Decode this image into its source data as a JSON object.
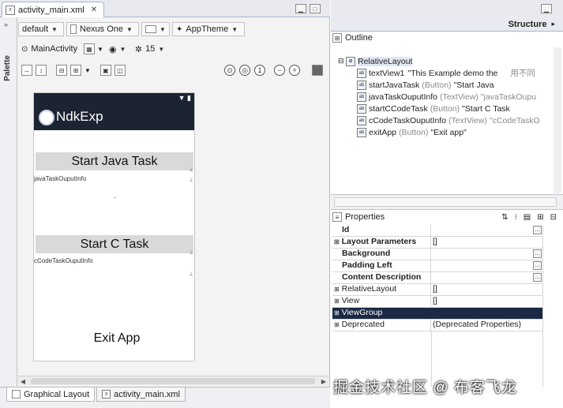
{
  "editor_tab": {
    "title": "activity_main.xml"
  },
  "palette": {
    "label": "Palette"
  },
  "toolbar1": {
    "config": "default",
    "device": "Nexus One",
    "theme": "AppTheme"
  },
  "toolbar2": {
    "activity": "MainActivity",
    "api": "15"
  },
  "device_preview": {
    "app_title": "NdkExp",
    "start_java_label": "Start Java Task",
    "java_output_id": "javaTaskOuputInfo",
    "start_c_label": "Start C Task",
    "c_output_id": "cCodeTaskOuputInfo",
    "exit_label": "Exit App"
  },
  "bottom_tabs": [
    {
      "label": "Graphical Layout"
    },
    {
      "label": "activity_main.xml"
    }
  ],
  "structure": {
    "label": "Structure"
  },
  "outline": {
    "title": "Outline",
    "root": "RelativeLayout",
    "items": [
      {
        "name": "textView1",
        "type": "",
        "value": "\"This Example demo the",
        "extra": "用不同"
      },
      {
        "name": "startJavaTask",
        "type": "(Button)",
        "value": "\"Start Java"
      },
      {
        "name": "javaTaskOuputInfo",
        "type": "(TextView)",
        "value": "\"javaTaskOupu"
      },
      {
        "name": "startCCodeTask",
        "type": "(Button)",
        "value": "\"Start C Task"
      },
      {
        "name": "cCodeTaskOuputInfo",
        "type": "(TextView)",
        "value": "\"cCodeTaskO"
      },
      {
        "name": "exitApp",
        "type": "(Button)",
        "value": "\"Exit app\""
      }
    ]
  },
  "properties": {
    "title": "Properties",
    "rows": [
      {
        "key": "Id",
        "value": "",
        "bold": true
      },
      {
        "key": "Layout Parameters",
        "value": "[]",
        "bold": true
      },
      {
        "key": "Background",
        "value": "",
        "bold": true
      },
      {
        "key": "Padding Left",
        "value": "",
        "bold": true
      },
      {
        "key": "Content Description",
        "value": "",
        "bold": true
      },
      {
        "key": "RelativeLayout",
        "value": "[]",
        "bold": false
      },
      {
        "key": "View",
        "value": "[]",
        "bold": false
      },
      {
        "key": "ViewGroup",
        "value": "",
        "bold": false
      },
      {
        "key": "Deprecated",
        "value": "(Deprecated Properties)",
        "bold": false
      }
    ]
  },
  "watermark": "掘金技术社区 @ 布客飞龙"
}
